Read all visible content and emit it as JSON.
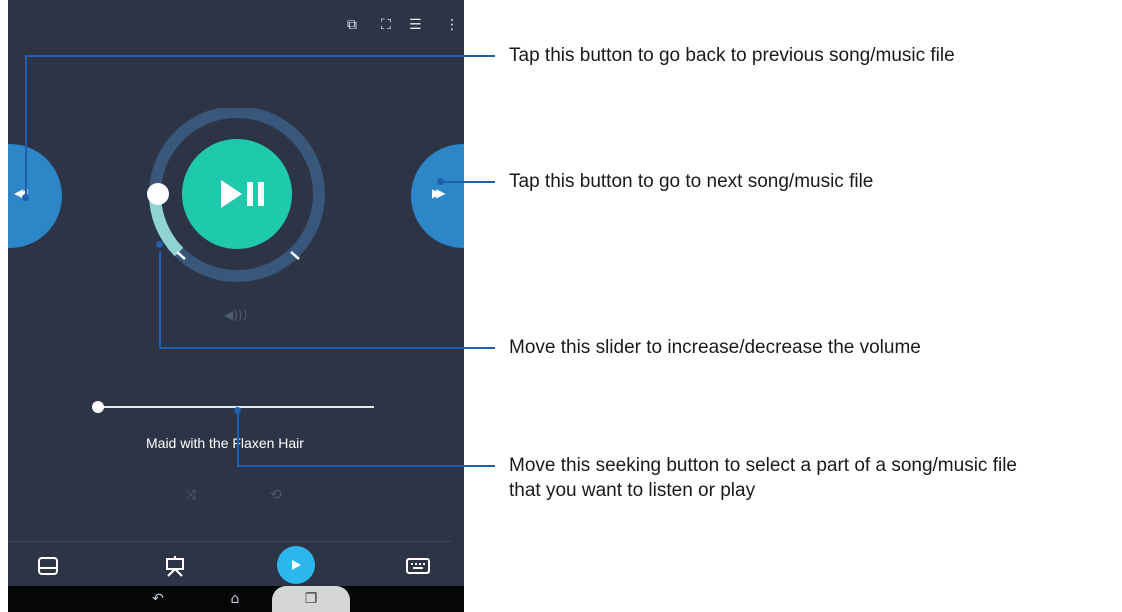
{
  "player": {
    "song_title": "Maid with the Flaxen Hair",
    "play_pause_glyph": "▶❚❚",
    "prev_glyph": "◀◀",
    "next_glyph": "▶▶",
    "volume_glyph": "🔊",
    "volume_level": 0.16,
    "seek_position": 0.0,
    "icons": {
      "top": [
        "crop-window-icon",
        "fullscreen-icon",
        "playlist-icon",
        "more-options-icon"
      ],
      "controls": [
        "shuffle-icon",
        "repeat-icon"
      ],
      "bottom": [
        "touchpad-icon",
        "presentation-icon",
        "play-icon",
        "keyboard-icon"
      ],
      "nav": [
        "back-icon",
        "home-icon",
        "recent-apps-icon"
      ]
    },
    "colors": {
      "background": "#2c3446",
      "side_button": "#2d86c7",
      "play_button": "#1fc9ab",
      "ring": "#38577a",
      "volume_arc": "#8fd3d3",
      "bottom_play": "#2bb7ee",
      "callout_line": "#1f5fae"
    }
  },
  "annotations": {
    "prev": "Tap this button to go back to previous song/music file",
    "next": "Tap this button to go to next song/music file",
    "volume": "Move this slider to increase/decrease the volume",
    "seek_line1": "Move this seeking button to select a part of a song/music file",
    "seek_line2": "that you want to listen or play"
  }
}
